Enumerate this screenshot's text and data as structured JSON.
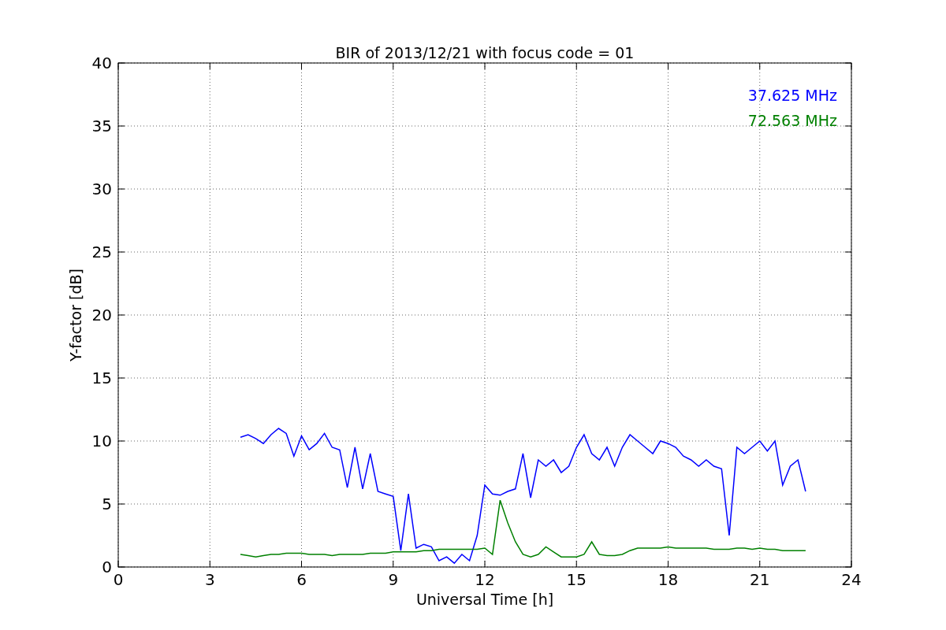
{
  "chart_data": {
    "type": "line",
    "title": "BIR of 2013/12/21 with focus code = 01",
    "xlabel": "Universal Time [h]",
    "ylabel": "Y-factor [dB]",
    "x": [
      4.0,
      4.25,
      4.5,
      4.75,
      5.0,
      5.25,
      5.5,
      5.75,
      6.0,
      6.25,
      6.5,
      6.75,
      7.0,
      7.25,
      7.5,
      7.75,
      8.0,
      8.25,
      8.5,
      8.75,
      9.0,
      9.25,
      9.5,
      9.75,
      10.0,
      10.25,
      10.5,
      10.75,
      11.0,
      11.25,
      11.5,
      11.75,
      12.0,
      12.25,
      12.5,
      12.75,
      13.0,
      13.25,
      13.5,
      13.75,
      14.0,
      14.25,
      14.5,
      14.75,
      15.0,
      15.25,
      15.5,
      15.75,
      16.0,
      16.25,
      16.5,
      16.75,
      17.0,
      17.25,
      17.5,
      17.75,
      18.0,
      18.25,
      18.5,
      18.75,
      19.0,
      19.25,
      19.5,
      19.75,
      20.0,
      20.25,
      20.5,
      20.75,
      21.0,
      21.25,
      21.5,
      21.75,
      22.0,
      22.25,
      22.5
    ],
    "series": [
      {
        "name": "37.625 MHz",
        "color": "#0000ff",
        "values": [
          10.3,
          10.5,
          10.2,
          9.8,
          10.5,
          11.0,
          10.6,
          8.8,
          10.4,
          9.3,
          9.8,
          10.6,
          9.5,
          9.3,
          6.3,
          9.5,
          6.2,
          9.0,
          6.0,
          5.8,
          5.6,
          1.3,
          5.8,
          1.5,
          1.8,
          1.6,
          0.5,
          0.8,
          0.3,
          1.0,
          0.5,
          2.5,
          6.5,
          5.8,
          5.7,
          6.0,
          6.2,
          9.0,
          5.5,
          8.5,
          8.0,
          8.5,
          7.5,
          8.0,
          9.5,
          10.5,
          9.0,
          8.5,
          9.5,
          8.0,
          9.5,
          10.5,
          10.0,
          9.5,
          9.0,
          10.0,
          9.8,
          9.5,
          8.8,
          8.5,
          8.0,
          8.5,
          8.0,
          7.8,
          2.5,
          9.5,
          9.0,
          9.5,
          10.0,
          9.2,
          10.0,
          6.5,
          8.0,
          8.5,
          6.0
        ]
      },
      {
        "name": "72.563 MHz",
        "color": "#008000",
        "values": [
          1.0,
          0.9,
          0.8,
          0.9,
          1.0,
          1.0,
          1.1,
          1.1,
          1.1,
          1.0,
          1.0,
          1.0,
          0.9,
          1.0,
          1.0,
          1.0,
          1.0,
          1.1,
          1.1,
          1.1,
          1.2,
          1.2,
          1.2,
          1.2,
          1.3,
          1.3,
          1.4,
          1.4,
          1.4,
          1.4,
          1.4,
          1.4,
          1.5,
          1.0,
          5.3,
          3.5,
          2.0,
          1.0,
          0.8,
          1.0,
          1.6,
          1.2,
          0.8,
          0.8,
          0.8,
          1.0,
          2.0,
          1.0,
          0.9,
          0.9,
          1.0,
          1.3,
          1.5,
          1.5,
          1.5,
          1.5,
          1.6,
          1.5,
          1.5,
          1.5,
          1.5,
          1.5,
          1.4,
          1.4,
          1.4,
          1.5,
          1.5,
          1.4,
          1.5,
          1.4,
          1.4,
          1.3,
          1.3,
          1.3,
          1.3
        ]
      }
    ],
    "grid": true,
    "xlim": [
      0,
      24
    ],
    "ylim": [
      0,
      40
    ],
    "xticks": [
      0,
      3,
      6,
      9,
      12,
      15,
      18,
      21,
      24
    ],
    "yticks": [
      0,
      5,
      10,
      15,
      20,
      25,
      30,
      35,
      40
    ]
  }
}
